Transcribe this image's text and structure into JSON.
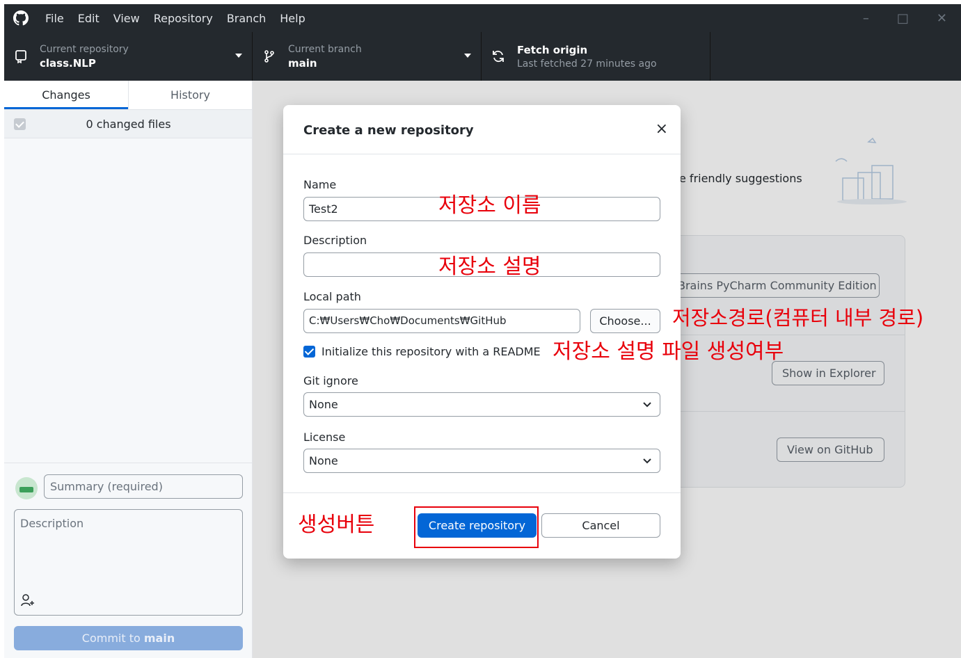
{
  "menubar": {
    "items": [
      "File",
      "Edit",
      "View",
      "Repository",
      "Branch",
      "Help"
    ]
  },
  "toolbar": {
    "repo_label": "Current repository",
    "repo_value": "class.NLP",
    "branch_label": "Current branch",
    "branch_value": "main",
    "fetch_label": "Fetch origin",
    "fetch_value": "Last fetched 27 minutes ago"
  },
  "sidebar": {
    "tabs": [
      "Changes",
      "History"
    ],
    "changed_files": "0 changed files",
    "summary_placeholder": "Summary (required)",
    "description_placeholder": "Description",
    "commit_prefix": "Commit to ",
    "commit_branch": "main"
  },
  "main": {
    "suggestions_text": "e friendly suggestions",
    "buttons": [
      "Brains PyCharm Community Edition",
      "Show in Explorer",
      "View on GitHub"
    ]
  },
  "dialog": {
    "title": "Create a new repository",
    "close": "×",
    "name_label": "Name",
    "name_value": "Test2",
    "description_label": "Description",
    "description_value": "",
    "local_path_label": "Local path",
    "local_path_value": "C:₩Users₩Cho₩Documents₩GitHub",
    "choose_label": "Choose...",
    "readme_label": "Initialize this repository with a README",
    "readme_checked": true,
    "gitignore_label": "Git ignore",
    "gitignore_value": "None",
    "license_label": "License",
    "license_value": "None",
    "create_label": "Create repository",
    "cancel_label": "Cancel"
  },
  "annotations": {
    "name": "저장소 이름",
    "description": "저장소 설명",
    "path": "저장소경로(컴퓨터 내부 경로)",
    "readme": "저장소 설명 파일 생성여부",
    "create": "생성버튼"
  },
  "colors": {
    "titlebar": "#24292e",
    "accent": "#0366d6",
    "annotation": "#e8000b"
  }
}
